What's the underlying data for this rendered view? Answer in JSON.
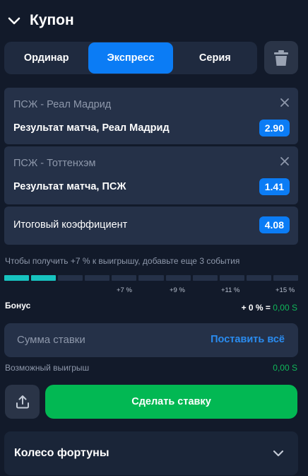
{
  "header": {
    "title": "Купон"
  },
  "tabs": [
    {
      "label": "Ординар",
      "active": false
    },
    {
      "label": "Экспресс",
      "active": true
    },
    {
      "label": "Серия",
      "active": false
    }
  ],
  "bets": [
    {
      "teams": "ПСЖ - Реал Мадрид",
      "market": "Результат матча, Реал Мадрид",
      "odd": "2.90"
    },
    {
      "teams": "ПСЖ - Тоттенхэм",
      "market": "Результат матча, ПСЖ",
      "odd": "1.41"
    }
  ],
  "total": {
    "label": "Итоговый коэффициент",
    "odd": "4.08"
  },
  "hint": "Чтобы получить +7 % к выигрышу, добавьте еще 3 события",
  "progress": {
    "segments_total": 11,
    "segments_filled": 2
  },
  "bonus_ticks": [
    "+7 %",
    "+9 %",
    "+11 %",
    "+15 %"
  ],
  "bonus": {
    "label": "Бонус",
    "prefix": "+ 0 % =",
    "value": "0,00 S"
  },
  "stake": {
    "placeholder": "Сумма ставки",
    "all_label": "Поставить всё"
  },
  "possible_win": {
    "label": "Возможный выигрыш",
    "value": "0,00 S"
  },
  "place_bet_label": "Сделать ставку",
  "fortune_wheel_label": "Колесо фортуны",
  "colors": {
    "accent": "#0b7cf5",
    "success": "#02b853",
    "progress": "#17c3c0",
    "background": "#121a2a"
  },
  "icons": [
    "chevron-down-icon",
    "trash-icon",
    "close-icon",
    "share-icon"
  ]
}
